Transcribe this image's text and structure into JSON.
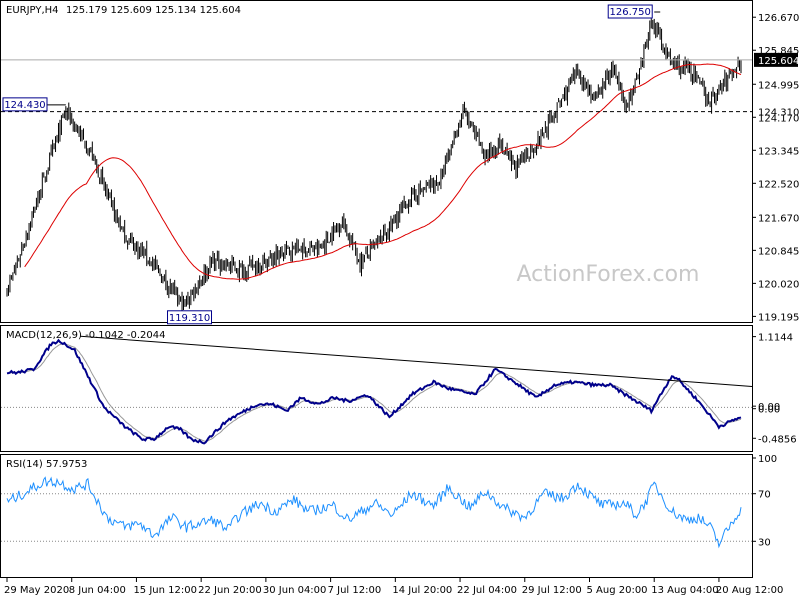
{
  "header": {
    "symbol": "EURJPY,H4",
    "ohlc": "125.179 125.609 125.134 125.604"
  },
  "watermark": "ActionForex.com",
  "colors": {
    "candle": "#000000",
    "sma": "#dd0000",
    "hline": "#000000",
    "current_line": "#aaaaaa",
    "macd": "#00008b",
    "signal": "#999999",
    "trendline": "#000000",
    "rsi": "#1e90ff",
    "grid_dotted": "#888888",
    "current_label_bg": "#000000",
    "current_label_fg": "#ffffff",
    "watermark": "#c8c8c8"
  },
  "chart_data": [
    {
      "type": "candlestick",
      "name": "price",
      "y_axis_ticks": [
        126.67,
        125.845,
        124.995,
        124.17,
        123.345,
        122.52,
        121.67,
        120.845,
        120.02,
        119.195
      ],
      "y_axis_tick_labels": [
        "126.670",
        "125.845",
        "124.995",
        "124.170",
        "123.345",
        "122.520",
        "121.670",
        "120.845",
        "120.020",
        "119.195"
      ],
      "ylim": [
        119.08,
        127.05
      ],
      "x_tick_labels": [
        "29 May 2020",
        "8 Jun 04:00",
        "15 Jun 12:00",
        "22 Jun 20:00",
        "30 Jun 04:00",
        "7 Jul 12:00",
        "14 Jul 20:00",
        "22 Jul 04:00",
        "29 Jul 12:00",
        "5 Aug 20:00",
        "13 Aug 04:00",
        "20 Aug 12:00"
      ],
      "x_tick_index": [
        0,
        44,
        88,
        132,
        176,
        220,
        264,
        308,
        352,
        396,
        440,
        484
      ],
      "bar_count": 500,
      "key_prices": [
        119.9,
        120.3,
        124.35,
        123.2,
        122.4,
        121.2,
        120.7,
        119.45,
        120.6,
        120.35,
        120.6,
        120.9,
        120.85,
        121.6,
        120.55,
        121.3,
        122.2,
        122.6,
        124.35,
        123.2,
        123.5,
        122.9,
        123.5,
        125.3,
        124.6,
        125.4,
        124.45,
        125.2,
        126.6,
        125.5,
        125.35,
        124.55,
        125.6
      ],
      "key_index": [
        0,
        5,
        40,
        58,
        66,
        80,
        95,
        120,
        140,
        160,
        178,
        195,
        212,
        228,
        240,
        258,
        275,
        295,
        310,
        325,
        335,
        345,
        360,
        388,
        400,
        412,
        420,
        430,
        438,
        452,
        465,
        478,
        499
      ],
      "series": [
        {
          "name": "SMA",
          "kind": "moving_average",
          "period": 55
        }
      ],
      "hlines": [
        {
          "value": 124.31,
          "label": "124.310",
          "style": "dashed"
        },
        {
          "value": 125.604,
          "label": "125.604",
          "style": "current"
        }
      ],
      "annotations": [
        {
          "text": "126.750",
          "value": 126.75,
          "index": 440
        },
        {
          "text": "124.430",
          "value": 124.43,
          "index": 40
        },
        {
          "text": "119.310",
          "value": 119.31,
          "index": 120
        }
      ]
    },
    {
      "type": "line",
      "name": "macd",
      "title": "MACD(12,26,9) -0.1042 -0.2044",
      "y_axis_tick_labels": [
        "1.1144",
        "0.00",
        "0.00",
        "-0.4856"
      ],
      "y_axis_ticks": [
        1.1144,
        0.02,
        -0.02,
        -0.4856
      ],
      "ylim": [
        -0.67,
        1.25
      ],
      "series": [
        {
          "name": "MACD",
          "key_values": [
            0.55,
            0.55,
            0.6,
            1.0,
            1.05,
            0.9,
            0.0,
            -0.3,
            -0.5,
            -0.5,
            -0.3,
            -0.35,
            -0.5,
            -0.55,
            -0.2,
            0.05,
            0.05,
            -0.05,
            0.15,
            0.05,
            0.15,
            0.1,
            0.2,
            -0.15,
            0.2,
            0.4,
            0.3,
            0.2,
            0.6,
            0.4,
            0.15,
            0.35,
            0.4,
            0.35,
            0.35,
            -0.05,
            0.5,
            0.45,
            0.1,
            -0.3,
            -0.15
          ],
          "key_index": [
            0,
            8,
            18,
            30,
            36,
            46,
            66,
            80,
            92,
            100,
            110,
            118,
            125,
            134,
            150,
            170,
            180,
            190,
            200,
            212,
            222,
            232,
            245,
            260,
            275,
            290,
            300,
            318,
            332,
            345,
            360,
            372,
            385,
            400,
            410,
            438,
            452,
            456,
            470,
            484,
            499
          ]
        },
        {
          "name": "Signal",
          "kind": "ema_of_macd",
          "period": 9
        }
      ],
      "trendline": {
        "from": {
          "index": 50,
          "value": 1.12
        },
        "to": {
          "index": 499,
          "value": 0.33
        }
      }
    },
    {
      "type": "line",
      "name": "rsi",
      "title": "RSI(14) 57.9753",
      "y_axis_ticks": [
        100,
        70,
        30
      ],
      "y_axis_tick_labels": [
        "100",
        "70",
        "30"
      ],
      "ylim": [
        0,
        100
      ],
      "series": [
        {
          "name": "RSI",
          "key_values": [
            63,
            68,
            80,
            80,
            74,
            78,
            50,
            42,
            45,
            35,
            50,
            42,
            48,
            40,
            52,
            62,
            55,
            65,
            55,
            60,
            48,
            62,
            52,
            70,
            60,
            75,
            58,
            72,
            58,
            50,
            70,
            66,
            78,
            70,
            60,
            62,
            52,
            65,
            78,
            55,
            48,
            50,
            42,
            28,
            58
          ],
          "key_index": [
            0,
            8,
            25,
            35,
            45,
            55,
            68,
            80,
            90,
            100,
            112,
            122,
            140,
            150,
            158,
            172,
            182,
            195,
            205,
            222,
            232,
            250,
            262,
            275,
            290,
            300,
            315,
            325,
            338,
            352,
            365,
            378,
            388,
            395,
            405,
            420,
            428,
            435,
            440,
            452,
            462,
            470,
            478,
            484,
            499
          ]
        }
      ]
    }
  ]
}
